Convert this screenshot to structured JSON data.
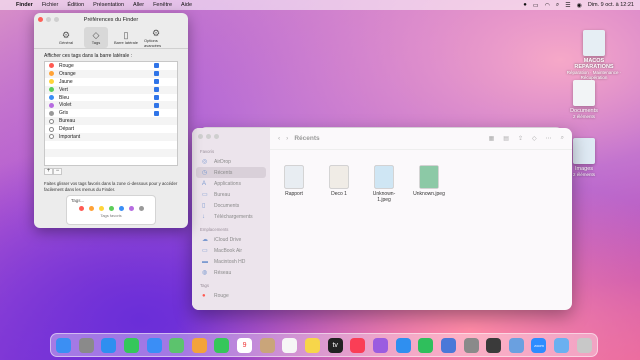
{
  "menubar": {
    "app": "Finder",
    "items": [
      "Fichier",
      "Édition",
      "Présentation",
      "Aller",
      "Fenêtre",
      "Aide"
    ],
    "clock": "Dim. 9 oct. à 12:21"
  },
  "prefs": {
    "title": "Préférences du Finder",
    "tabs": [
      {
        "label": "Général",
        "icon": "gear-icon"
      },
      {
        "label": "Tags",
        "icon": "tag-icon"
      },
      {
        "label": "Barre latérale",
        "icon": "sidebar-icon"
      },
      {
        "label": "Options avancées",
        "icon": "gears-icon"
      }
    ],
    "lead": "Afficher ces tags dans la barre latérale :",
    "tags": [
      {
        "label": "Rouge",
        "color": "#ff5a52"
      },
      {
        "label": "Orange",
        "color": "#ffa236"
      },
      {
        "label": "Jaune",
        "color": "#ffd43a"
      },
      {
        "label": "Vert",
        "color": "#5ccd5a"
      },
      {
        "label": "Bleu",
        "color": "#3a8ef6"
      },
      {
        "label": "Violet",
        "color": "#b66ce0"
      },
      {
        "label": "Gris",
        "color": "#9a9a9a"
      },
      {
        "label": "Bureau",
        "color": ""
      },
      {
        "label": "Départ",
        "color": ""
      },
      {
        "label": "Important",
        "color": ""
      }
    ],
    "note": "Faites glisser vos tags favoris dans la zone ci-dessous pour y accéder facilement dans les menus du Finder.",
    "fav_title": "Tags...",
    "fav_label": "Tags favoris",
    "fav_colors": [
      "#ff5a52",
      "#ffa236",
      "#ffd43a",
      "#5ccd5a",
      "#3a8ef6",
      "#b66ce0",
      "#9a9a9a"
    ]
  },
  "desktop": {
    "item1": {
      "title": "MACOS REPARATIONS",
      "sub": "Réparation · Maintenance · Récupération"
    },
    "documents": {
      "title": "Documents",
      "sub": "2 éléments"
    },
    "images": {
      "title": "Images",
      "sub": "2 éléments"
    }
  },
  "finder": {
    "title": "Récents",
    "sidebar": [
      {
        "section": "Favoris"
      },
      {
        "label": "AirDrop",
        "icon": "airdrop-icon"
      },
      {
        "label": "Récents",
        "icon": "clock-icon",
        "selected": true
      },
      {
        "label": "Applications",
        "icon": "apps-icon"
      },
      {
        "label": "Bureau",
        "icon": "desktop-icon"
      },
      {
        "label": "Documents",
        "icon": "document-icon"
      },
      {
        "label": "Téléchargements",
        "icon": "download-icon"
      },
      {
        "section": "Emplacements"
      },
      {
        "label": "iCloud Drive",
        "icon": "cloud-icon"
      },
      {
        "label": "MacBook Air",
        "icon": "laptop-icon"
      },
      {
        "label": "Macintosh HD",
        "icon": "disk-icon"
      },
      {
        "label": "Réseau",
        "icon": "network-icon"
      },
      {
        "section": "Tags"
      },
      {
        "label": "Rouge",
        "icon": "tag-dot-icon"
      }
    ],
    "files": [
      {
        "name": "Rapport",
        "color": "#e8edf2"
      },
      {
        "name": "Deco 1",
        "color": "#f0ece6"
      },
      {
        "name": "Unknown-1.jpeg",
        "color": "#cfe6f4"
      },
      {
        "name": "Unknown.jpeg",
        "color": "#8cc9a6"
      }
    ]
  },
  "dock": {
    "apps": [
      "finder-icon",
      "launchpad-icon",
      "safari-icon",
      "messages-icon",
      "mail-icon",
      "maps-icon",
      "photos-icon",
      "facetime-icon",
      "calendar-icon",
      "contacts-icon",
      "reminders-icon",
      "notes-icon",
      "tv-icon",
      "music-icon",
      "podcasts-icon",
      "appstore-icon",
      "numbers-icon",
      "keynote-icon",
      "settings-icon",
      "quicktime-icon",
      "preview-icon",
      "zoom-icon",
      "folder-icon",
      "trash-icon"
    ],
    "colors": [
      "#3b8ff3",
      "#8a8a8a",
      "#2f8ff0",
      "#35c75a",
      "#3a8ef6",
      "#5cc36d",
      "#f3a33a",
      "#35c75a",
      "#ffffff",
      "#c9a57a",
      "#f6f6f6",
      "#f7d64a",
      "#222222",
      "#fa3e56",
      "#9b5ce0",
      "#2f8ff0",
      "#2fbf5c",
      "#4a78d8",
      "#8a8a8a",
      "#3a3a3a",
      "#6aa0e0",
      "#2d8cff",
      "#6ab0f0",
      "#c8c8c8"
    ],
    "calendar_day": "9",
    "tv_label": "tv",
    "zoom_label": "zoom"
  }
}
